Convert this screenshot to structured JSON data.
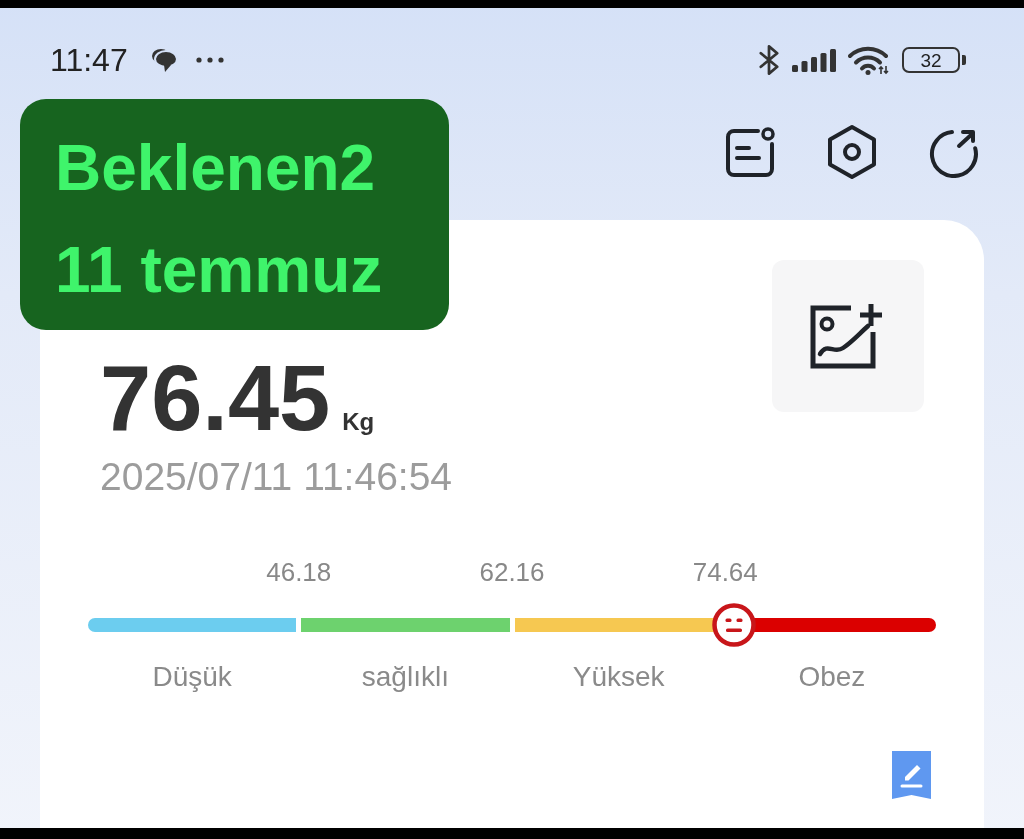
{
  "status_bar": {
    "time": "11:47",
    "battery": "32"
  },
  "annotation": {
    "lines": [
      "Beklenen2",
      "11 temmuz"
    ]
  },
  "measurement": {
    "weight": "76.45",
    "unit": "Kg",
    "timestamp": "2025/07/11 11:46:54"
  },
  "scale": {
    "thresholds": [
      "46.18",
      "62.16",
      "74.64"
    ],
    "level": 0.762,
    "segments": [
      {
        "label": "Düşük",
        "color": "#6ccdef"
      },
      {
        "label": "sağlıklı",
        "color": "#6dd26e"
      },
      {
        "label": "Yüksek",
        "color": "#f6c851"
      },
      {
        "label": "Obez",
        "color": "#db0000"
      }
    ]
  }
}
